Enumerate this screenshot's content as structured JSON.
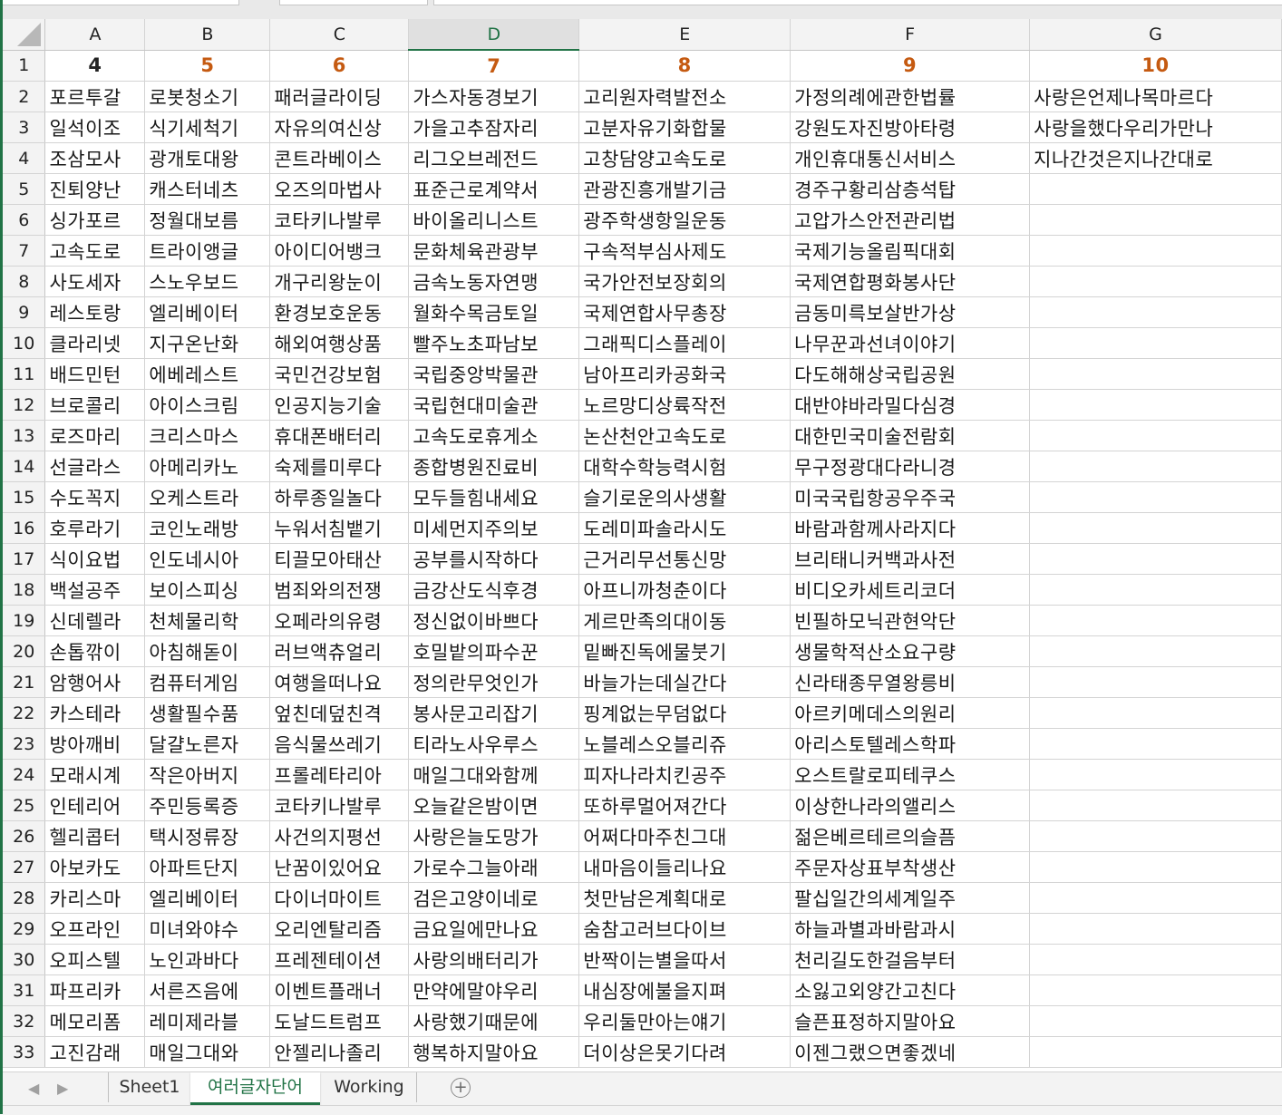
{
  "columns": [
    "A",
    "B",
    "C",
    "D",
    "E",
    "F",
    "G"
  ],
  "selected_column": "D",
  "rows": [
    [
      "1",
      "4",
      "5",
      "6",
      "7",
      "8",
      "9",
      "10"
    ],
    [
      "2",
      "포르투갈",
      "로봇청소기",
      "패러글라이딩",
      "가스자동경보기",
      "고리원자력발전소",
      "가정의례에관한법률",
      "사랑은언제나목마르다"
    ],
    [
      "3",
      "일석이조",
      "식기세척기",
      "자유의여신상",
      "가을고추잠자리",
      "고분자유기화합물",
      "강원도자진방아타령",
      "사랑을했다우리가만나"
    ],
    [
      "4",
      "조삼모사",
      "광개토대왕",
      "콘트라베이스",
      "리그오브레전드",
      "고창담양고속도로",
      "개인휴대통신서비스",
      "지나간것은지나간대로"
    ],
    [
      "5",
      "진퇴양난",
      "캐스터네츠",
      "오즈의마법사",
      "표준근로계약서",
      "관광진흥개발기금",
      "경주구황리삼층석탑",
      ""
    ],
    [
      "6",
      "싱가포르",
      "정월대보름",
      "코타키나발루",
      "바이올리니스트",
      "광주학생항일운동",
      "고압가스안전관리법",
      ""
    ],
    [
      "7",
      "고속도로",
      "트라이앵글",
      "아이디어뱅크",
      "문화체육관광부",
      "구속적부심사제도",
      "국제기능올림픽대회",
      ""
    ],
    [
      "8",
      "사도세자",
      "스노우보드",
      "개구리왕눈이",
      "금속노동자연맹",
      "국가안전보장회의",
      "국제연합평화봉사단",
      ""
    ],
    [
      "9",
      "레스토랑",
      "엘리베이터",
      "환경보호운동",
      "월화수목금토일",
      "국제연합사무총장",
      "금동미륵보살반가상",
      ""
    ],
    [
      "10",
      "클라리넷",
      "지구온난화",
      "해외여행상품",
      "빨주노초파남보",
      "그래픽디스플레이",
      "나무꾼과선녀이야기",
      ""
    ],
    [
      "11",
      "배드민턴",
      "에베레스트",
      "국민건강보험",
      "국립중앙박물관",
      "남아프리카공화국",
      "다도해해상국립공원",
      ""
    ],
    [
      "12",
      "브로콜리",
      "아이스크림",
      "인공지능기술",
      "국립현대미술관",
      "노르망디상륙작전",
      "대반야바라밀다심경",
      ""
    ],
    [
      "13",
      "로즈마리",
      "크리스마스",
      "휴대폰배터리",
      "고속도로휴게소",
      "논산천안고속도로",
      "대한민국미술전람회",
      ""
    ],
    [
      "14",
      "선글라스",
      "아메리카노",
      "숙제를미루다",
      "종합병원진료비",
      "대학수학능력시험",
      "무구정광대다라니경",
      ""
    ],
    [
      "15",
      "수도꼭지",
      "오케스트라",
      "하루종일놀다",
      "모두들힘내세요",
      "슬기로운의사생활",
      "미국국립항공우주국",
      ""
    ],
    [
      "16",
      "호루라기",
      "코인노래방",
      "누워서침뱉기",
      "미세먼지주의보",
      "도레미파솔라시도",
      "바람과함께사라지다",
      ""
    ],
    [
      "17",
      "식이요법",
      "인도네시아",
      "티끌모아태산",
      "공부를시작하다",
      "근거리무선통신망",
      "브리태니커백과사전",
      ""
    ],
    [
      "18",
      "백설공주",
      "보이스피싱",
      "범죄와의전쟁",
      "금강산도식후경",
      "아프니까청춘이다",
      "비디오카세트리코더",
      ""
    ],
    [
      "19",
      "신데렐라",
      "천체물리학",
      "오페라의유령",
      "정신없이바쁘다",
      "게르만족의대이동",
      "빈필하모닉관현악단",
      ""
    ],
    [
      "20",
      "손톱깎이",
      "아침해돋이",
      "러브액츄얼리",
      "호밀밭의파수꾼",
      "밑빠진독에물붓기",
      "생물학적산소요구량",
      ""
    ],
    [
      "21",
      "암행어사",
      "컴퓨터게임",
      "여행을떠나요",
      "정의란무엇인가",
      "바늘가는데실간다",
      "신라태종무열왕릉비",
      ""
    ],
    [
      "22",
      "카스테라",
      "생활필수품",
      "엎친데덮친격",
      "봉사문고리잡기",
      "핑계없는무덤없다",
      "아르키메데스의원리",
      ""
    ],
    [
      "23",
      "방아깨비",
      "달걀노른자",
      "음식물쓰레기",
      "티라노사우루스",
      "노블레스오블리쥬",
      "아리스토텔레스학파",
      ""
    ],
    [
      "24",
      "모래시계",
      "작은아버지",
      "프롤레타리아",
      "매일그대와함께",
      "피자나라치킨공주",
      "오스트랄로피테쿠스",
      ""
    ],
    [
      "25",
      "인테리어",
      "주민등록증",
      "코타키나발루",
      "오늘같은밤이면",
      "또하루멀어져간다",
      "이상한나라의앨리스",
      ""
    ],
    [
      "26",
      "헬리콥터",
      "택시정류장",
      "사건의지평선",
      "사랑은늘도망가",
      "어쩌다마주친그대",
      "젊은베르테르의슬픔",
      ""
    ],
    [
      "27",
      "아보카도",
      "아파트단지",
      "난꿈이있어요",
      "가로수그늘아래",
      "내마음이들리나요",
      "주문자상표부착생산",
      ""
    ],
    [
      "28",
      "카리스마",
      "엘리베이터",
      "다이너마이트",
      "검은고양이네로",
      "첫만남은계획대로",
      "팔십일간의세계일주",
      ""
    ],
    [
      "29",
      "오프라인",
      "미녀와야수",
      "오리엔탈리즘",
      "금요일에만나요",
      "숨참고러브다이브",
      "하늘과별과바람과시",
      ""
    ],
    [
      "30",
      "오피스텔",
      "노인과바다",
      "프레젠테이션",
      "사랑의배터리가",
      "반짝이는별을따서",
      "천리길도한걸음부터",
      ""
    ],
    [
      "31",
      "파프리카",
      "서른즈음에",
      "이벤트플래너",
      "만약에말야우리",
      "내심장에불을지펴",
      "소잃고외양간고친다",
      ""
    ],
    [
      "32",
      "메모리폼",
      "레미제라블",
      "도날드트럼프",
      "사랑했기때문에",
      "우리둘만아는얘기",
      "슬픈표정하지말아요",
      ""
    ],
    [
      "33",
      "고진감래",
      "매일그대와",
      "안젤리나졸리",
      "행복하지말아요",
      "더이상은못기다려",
      "이젠그랬으면좋겠네",
      ""
    ]
  ],
  "sheet_tabs": [
    "Sheet1",
    "여러글자단어",
    "Working"
  ],
  "active_tab_index": 1,
  "add_sheet_symbol": "+",
  "nav_prev": "◀",
  "nav_next": "▶",
  "colors": {
    "accent": "#217346",
    "header_number": "#c55a11"
  }
}
